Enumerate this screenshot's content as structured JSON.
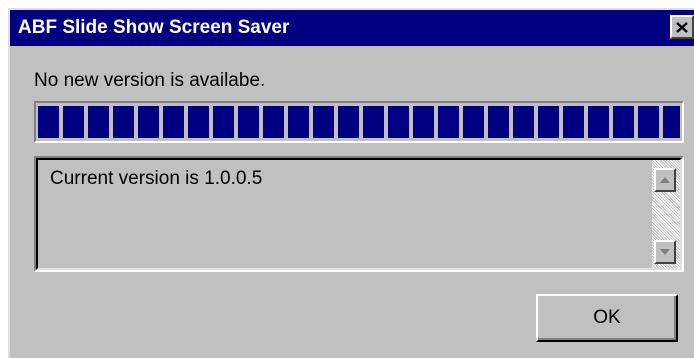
{
  "window": {
    "title": "ABF Slide Show Screen Saver",
    "close_icon": "close-icon",
    "colors": {
      "titlebar": "#000080",
      "face": "#c0c0c0",
      "progress": "#000080"
    }
  },
  "status": {
    "message": "No new version is availabe.",
    "progress": 1.0
  },
  "log": {
    "text": "Current version is 1.0.0.5",
    "scroll_up_icon": "scroll-up-arrow-icon",
    "scroll_down_icon": "scroll-down-arrow-icon"
  },
  "buttons": {
    "ok_label": "OK"
  }
}
